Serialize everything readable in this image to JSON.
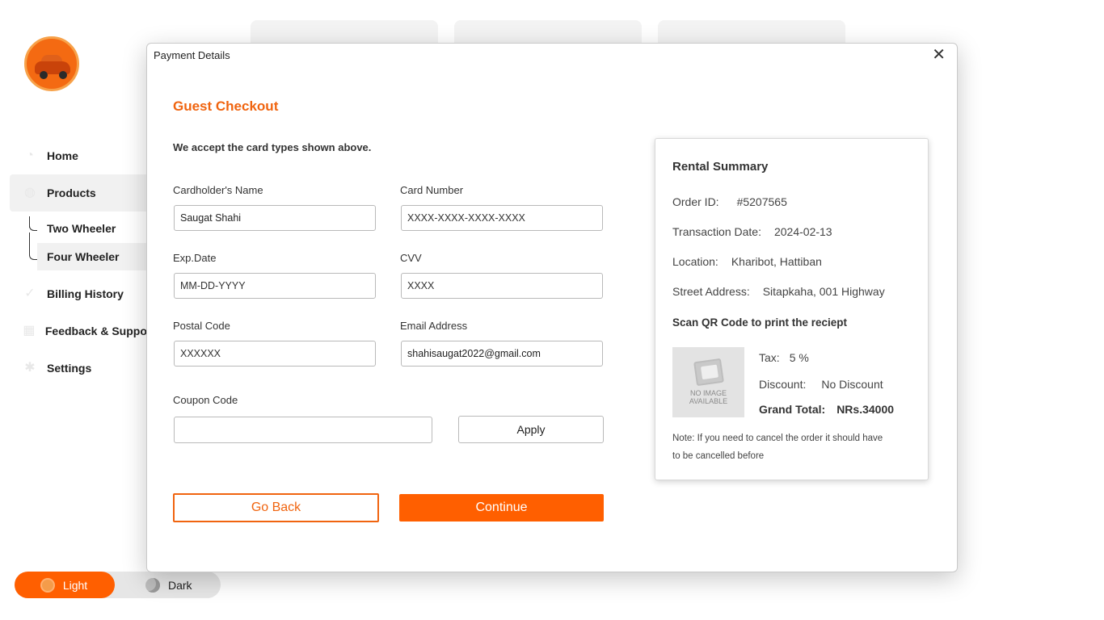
{
  "sidebar": {
    "items": [
      {
        "label": "Home",
        "icon": "home-icon"
      },
      {
        "label": "Products",
        "icon": "products-icon"
      },
      {
        "label": "Billing History",
        "icon": "billing-icon"
      },
      {
        "label": "Feedback & Support",
        "icon": "feedback-icon"
      },
      {
        "label": "Settings",
        "icon": "settings-icon"
      }
    ],
    "sub_items": [
      {
        "label": "Two Wheeler"
      },
      {
        "label": "Four Wheeler"
      }
    ],
    "theme": {
      "light_label": "Light",
      "dark_label": "Dark"
    }
  },
  "modal": {
    "title": "Payment Details",
    "close_glyph": "✕",
    "heading": "Guest Checkout",
    "accept_text": "We accept the card types shown above.",
    "fields": {
      "cardholder": {
        "label": "Cardholder's Name",
        "value": "Saugat Shahi",
        "placeholder": ""
      },
      "card_number": {
        "label": "Card Number",
        "value": "",
        "placeholder": "XXXX-XXXX-XXXX-XXXX"
      },
      "exp_date": {
        "label": "Exp.Date",
        "value": "",
        "placeholder": "MM-DD-YYYY"
      },
      "cvv": {
        "label": "CVV",
        "value": "",
        "placeholder": "XXXX"
      },
      "postal": {
        "label": "Postal Code",
        "value": "",
        "placeholder": "XXXXXX"
      },
      "email": {
        "label": "Email Address",
        "value": "shahisaugat2022@gmail.com",
        "placeholder": ""
      },
      "coupon": {
        "label": "Coupon Code",
        "value": "",
        "placeholder": ""
      }
    },
    "buttons": {
      "apply": "Apply",
      "back": "Go Back",
      "continue": "Continue"
    }
  },
  "summary": {
    "title": "Rental Summary",
    "order_id": {
      "label": "Order ID:",
      "value": "#5207565"
    },
    "transaction_date": {
      "label": "Transaction Date:",
      "value": "2024-02-13"
    },
    "location": {
      "label": "Location:",
      "value": "Kharibot, Hattiban"
    },
    "street": {
      "label": "Street Address:",
      "value": "Sitapkaha, 001 Highway"
    },
    "qr_text": "Scan QR Code to print the reciept",
    "no_image_text": "NO IMAGE AVAILABLE",
    "tax": {
      "label": "Tax:",
      "value": "5 %"
    },
    "discount": {
      "label": "Discount:",
      "value": "No Discount"
    },
    "grand_total": {
      "label": "Grand Total:",
      "value": "NRs.34000"
    },
    "note": "Note: If you need to cancel the order it should have to be cancelled before"
  },
  "colors": {
    "accent": "#ff5f00",
    "heading": "#f0640f"
  }
}
